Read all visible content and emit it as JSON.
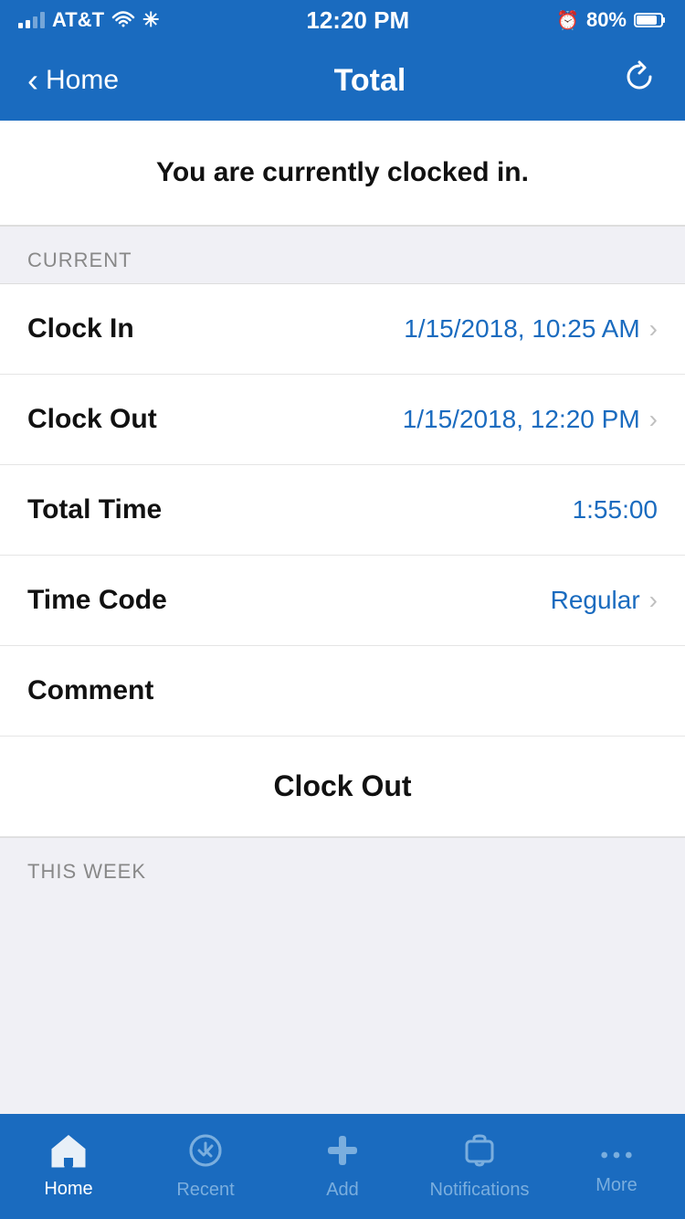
{
  "status_bar": {
    "carrier": "AT&T",
    "time": "12:20 PM",
    "battery": "80%"
  },
  "nav": {
    "back_label": "Home",
    "title": "Total",
    "refresh_label": "Refresh"
  },
  "clocked_in": {
    "message": "You are currently clocked in."
  },
  "sections": {
    "current_label": "CURRENT",
    "this_week_label": "THIS WEEK"
  },
  "rows": {
    "clock_in_label": "Clock In",
    "clock_in_value": "1/15/2018, 10:25 AM",
    "clock_out_label": "Clock Out",
    "clock_out_value": "1/15/2018, 12:20 PM",
    "total_time_label": "Total Time",
    "total_time_value": "1:55:00",
    "time_code_label": "Time Code",
    "time_code_value": "Regular",
    "comment_label": "Comment"
  },
  "clock_out_button": "Clock Out",
  "tab_bar": {
    "home_label": "Home",
    "recent_label": "Recent",
    "add_label": "Add",
    "notifications_label": "Notifications",
    "more_label": "More"
  }
}
